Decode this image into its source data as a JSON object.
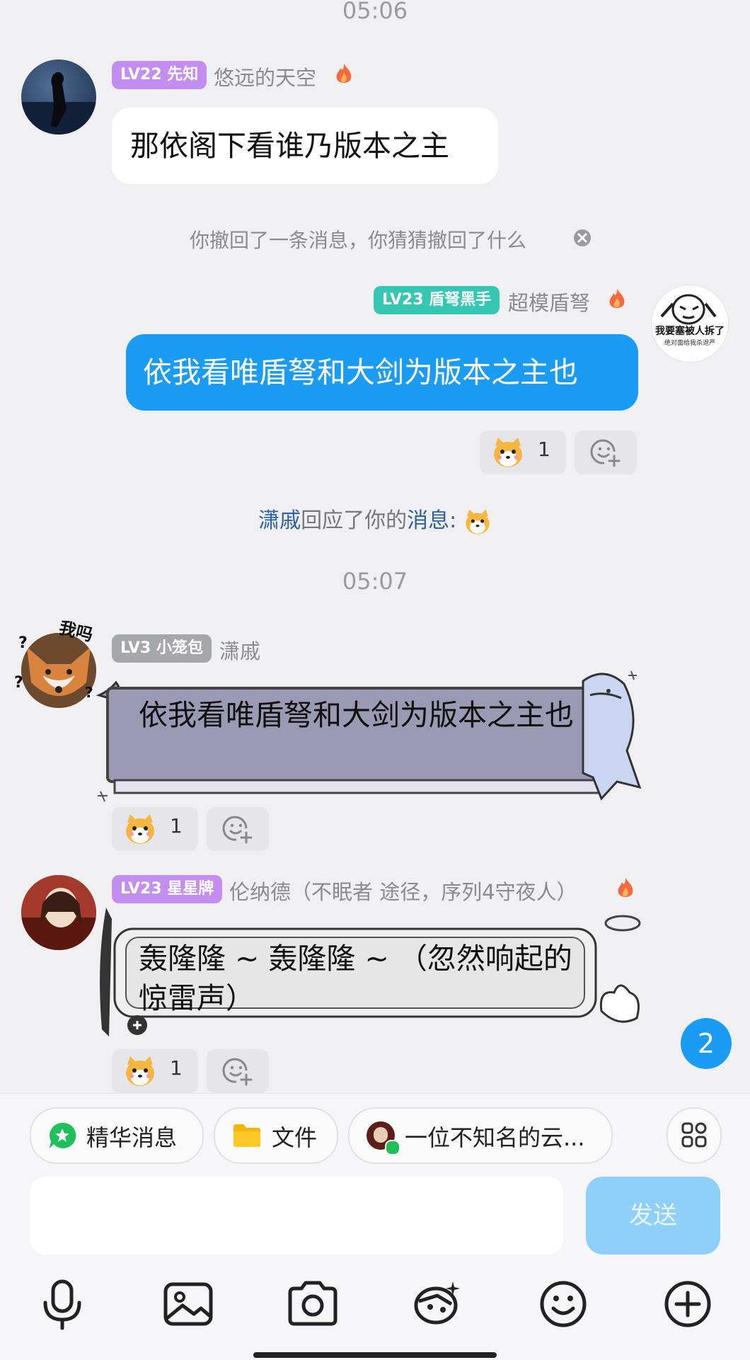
{
  "times": [
    "05:06",
    "05:07"
  ],
  "messages": [
    {
      "badge": "LV22 先知",
      "name": "悠远的天空",
      "text": "那依阁下看谁乃版本之主"
    },
    {
      "badge": "LV23 盾弩黑手",
      "name": "超模盾弩",
      "text": "依我看唯盾弩和大剑为版本之主也",
      "reaction_count": "1"
    },
    {
      "badge": "LV3 小笼包",
      "name": "潇戚",
      "text": "依我看唯盾弩和大剑为版本之主也",
      "reaction_count": "1"
    },
    {
      "badge": "LV23 星星牌",
      "name": "伦纳德（不眠者 途径，序列4守夜人）",
      "text": "轰隆隆 ~ 轰隆隆 ~ （忽然响起的惊雷声）",
      "reaction_count": "1"
    }
  ],
  "system": {
    "recall": "你撤回了一条消息，你猜猜撤回了什么",
    "reply_name": "潇戚",
    "reply_mid": "回应了你的",
    "reply_link": "消息:"
  },
  "avatar_texts": {
    "fox_doodle": "我吗",
    "meme_text_1": "我要塞被人拆了",
    "meme_text_2": "绝对面给我杀退严"
  },
  "unread_count": "2",
  "quick_bar": {
    "essence": "精华消息",
    "files": "文件",
    "member": "一位不知名的云..."
  },
  "send_button": "发送",
  "colors": {
    "accent_blue": "#1a9cf5",
    "lv22_badge": "#c48ef0",
    "lv23_badge": "#36c7b2",
    "lv3_badge": "#a6a6ad"
  },
  "icons": [
    "microphone-icon",
    "image-icon",
    "camera-icon",
    "red-packet-icon",
    "emoji-icon",
    "plus-icon",
    "grid-icon",
    "fire-icon",
    "close-icon"
  ]
}
